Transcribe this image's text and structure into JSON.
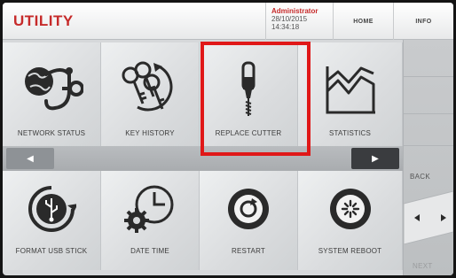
{
  "header": {
    "title": "UTILITY",
    "user": "Administrator",
    "date": "28/10/2015",
    "time": "14:34:18",
    "home_label": "HOME",
    "info_label": "INFO"
  },
  "tiles_row1": [
    {
      "label": "NETWORK STATUS",
      "icon": "network-status-icon"
    },
    {
      "label": "KEY HISTORY",
      "icon": "key-history-icon"
    },
    {
      "label": "REPLACE CUTTER",
      "icon": "cutter-icon"
    },
    {
      "label": "STATISTICS",
      "icon": "statistics-icon"
    }
  ],
  "tiles_row2": [
    {
      "label": "FORMAT USB STICK",
      "icon": "usb-format-icon"
    },
    {
      "label": "DATE TIME",
      "icon": "clock-icon"
    },
    {
      "label": "RESTART",
      "icon": "restart-icon"
    },
    {
      "label": "SYSTEM REBOOT",
      "icon": "reboot-icon"
    }
  ],
  "sidebar": {
    "back_label": "BACK",
    "next_label": "NEXT"
  },
  "colors": {
    "accent": "#c62a2a",
    "highlight": "#e01818"
  }
}
